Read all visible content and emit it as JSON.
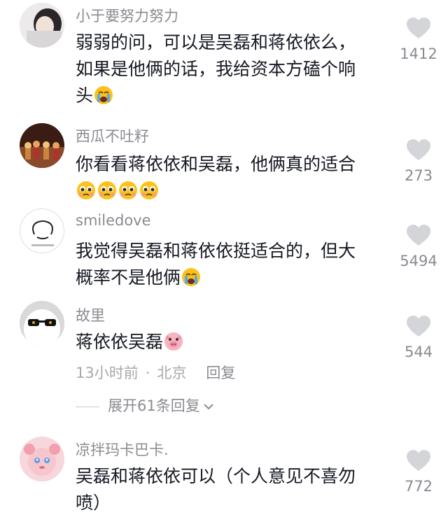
{
  "comments": [
    {
      "author": "小于要努力努力",
      "line1": "弱弱的问，可以是吴磊和蒋依依么，",
      "line2": "如果是他俩的话，我给资本方磕个响",
      "line3": "头",
      "likes": "1412"
    },
    {
      "author": "西瓜不吐籽",
      "line1": "你看看蒋依依和吴磊，他俩真的适合",
      "likes": "273"
    },
    {
      "author": "smiledove",
      "line1": "我觉得吴磊和蒋依依挺适合的，但大",
      "line2": "概率不是他俩",
      "likes": "5494"
    },
    {
      "author": "故里",
      "line1": "蒋依依吴磊",
      "likes": "544",
      "time": "13小时前",
      "dot": "·",
      "location": "北京",
      "reply_label": "回复",
      "expand_label": "展开61条回复"
    },
    {
      "author": "凉拌玛卡巴卡.",
      "line1": "吴磊和蒋依依可以（个人意见不喜勿",
      "line2": "喷）",
      "likes": "772"
    }
  ],
  "icons": {
    "heart": "heart-icon",
    "crying": "loudly-crying-face-icon",
    "pleading": "pleading-face-icon",
    "pig": "pig-face-icon",
    "chevron": "chevron-down-icon"
  },
  "colors": {
    "heart": "#d4d5d8",
    "meta": "#8a8b91",
    "text": "#161823"
  }
}
